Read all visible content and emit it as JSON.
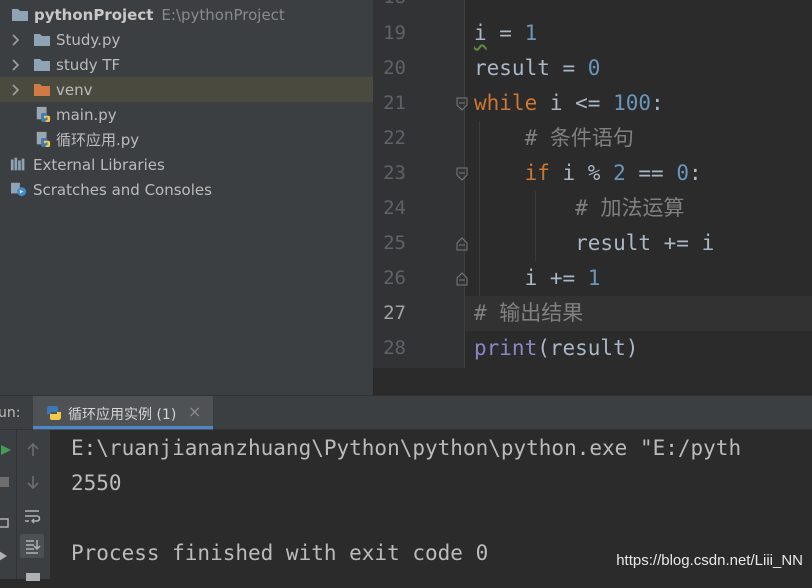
{
  "project_tree": {
    "root": {
      "name": "pythonProject",
      "path": "E:\\pythonProject"
    },
    "items": [
      {
        "label": "Study.py",
        "kind": "folder"
      },
      {
        "label": "study TF",
        "kind": "folder"
      },
      {
        "label": "venv",
        "kind": "folder-excluded"
      },
      {
        "label": "main.py",
        "kind": "python-file"
      },
      {
        "label": "循环应用.py",
        "kind": "python-file"
      },
      {
        "label": "External Libraries",
        "kind": "libraries"
      },
      {
        "label": "Scratches and Consoles",
        "kind": "scratches"
      }
    ]
  },
  "editor": {
    "current_line": "27",
    "lines": [
      {
        "number": "19",
        "text": "i = 1"
      },
      {
        "number": "20",
        "text": "result = 0"
      },
      {
        "number": "21",
        "text": "while i <= 100:"
      },
      {
        "number": "22",
        "text": "# 条件语句"
      },
      {
        "number": "23",
        "text": "if i % 2 == 0:"
      },
      {
        "number": "24",
        "text": "# 加法运算"
      },
      {
        "number": "25",
        "text": "result += i"
      },
      {
        "number": "26",
        "text": "i += 1"
      },
      {
        "number": "27",
        "text": "# 输出结果"
      },
      {
        "number": "28",
        "text": "print(result)"
      }
    ]
  },
  "run_panel": {
    "title": "un:",
    "tab_label": "循环应用实例 (1)",
    "output": [
      "E:\\ruanjiananzhuang\\Python\\python\\python.exe \"E:/pyth",
      "2550",
      "",
      "Process finished with exit code 0"
    ]
  },
  "watermark": "https://blog.csdn.net/Liii_NN",
  "colors": {
    "keyword": "#cc7832",
    "number": "#6897bb",
    "comment": "#808080",
    "builtin": "#8888c6",
    "text": "#a9b7c6",
    "accent": "#4a88c7"
  }
}
